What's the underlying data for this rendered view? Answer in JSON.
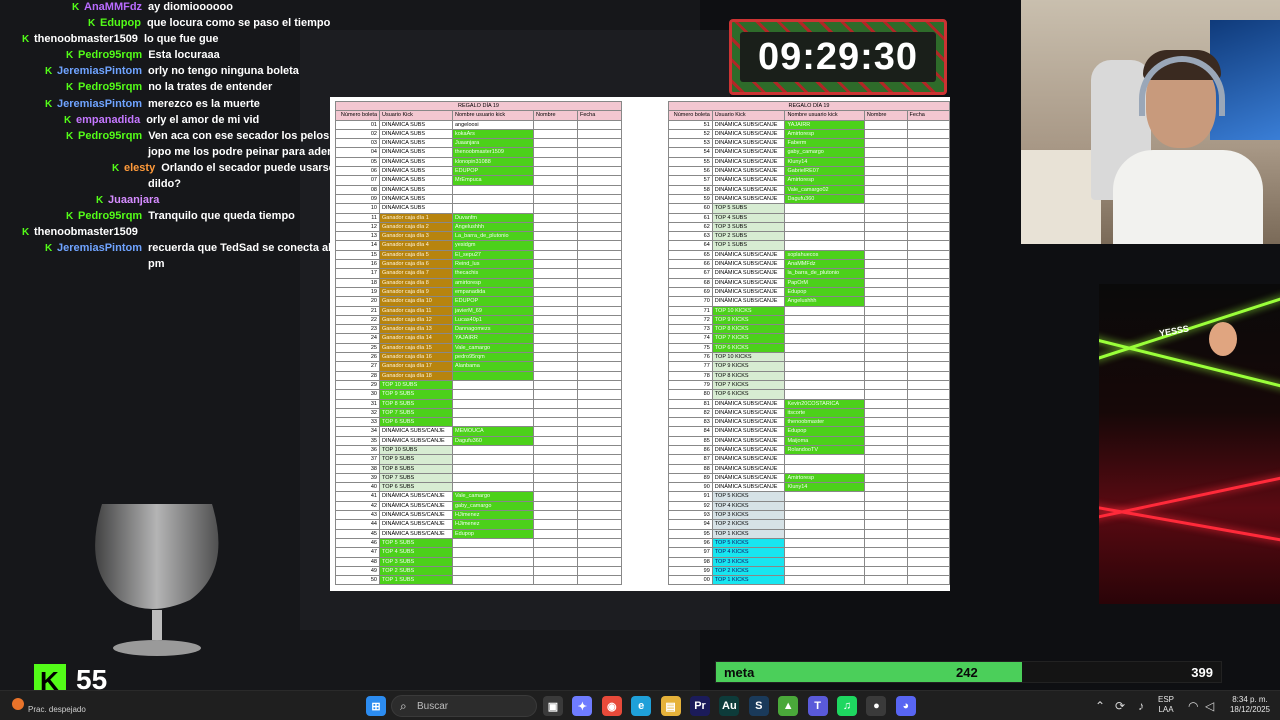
{
  "chat": {
    "messages": [
      {
        "user": "AnaMMFdz",
        "color": "#b96bff",
        "text": "ay diomioooooo"
      },
      {
        "user": "Edupop",
        "color": "#53fc18",
        "text": "que locura como se paso el tiempo"
      },
      {
        "user": "thenoobmaster1509",
        "color": "#ffffff",
        "text": "lo que fue gue"
      },
      {
        "user": "Pedro95rqm",
        "color": "#53fc18",
        "text": "Esta locuraaa"
      },
      {
        "user": "JeremiasPintom",
        "color": "#6fa3ff",
        "text": "orly no tengo ninguna boleta"
      },
      {
        "user": "Pedro95rqm",
        "color": "#53fc18",
        "text": "no la trates de entender"
      },
      {
        "user": "JeremiasPintom",
        "color": "#6fa3ff",
        "text": "merezco es la muerte"
      },
      {
        "user": "empanadida",
        "color": "#c477ff",
        "text": "orly el amor de mi vid"
      },
      {
        "user": "Pedro95rqm",
        "color": "#53fc18",
        "text": "Ven aca con ese secador los pelos del"
      },
      {
        "user": "",
        "color": "#ffffff",
        "text": "jopo me los podre peinar para ader"
      },
      {
        "user": "elesty",
        "color": "#ff9a3a",
        "text": "Orlando el secador puede usarse como"
      },
      {
        "user": "",
        "color": "#ffffff",
        "text": "dildo?"
      },
      {
        "user": "Juaanjara",
        "color": "#d58cff",
        "text": ""
      },
      {
        "user": "Pedro95rqm",
        "color": "#53fc18",
        "text": "Tranquilo que queda tiempo"
      },
      {
        "user": "thenoobmaster1509",
        "color": "#ffffff",
        "text": ""
      },
      {
        "user": "JeremiasPintom",
        "color": "#6fa3ff",
        "text": "recuerda que TedSad se conecta al"
      },
      {
        "user": "",
        "color": "#ffffff",
        "text": "pm"
      }
    ]
  },
  "timer": {
    "value": "09:29:30"
  },
  "sheet": {
    "title": "REGALO DÍA 19",
    "headers": [
      "Número boleta",
      "Usuario Kick",
      "Nombre usuario kick",
      "Nombre",
      "Fecha"
    ],
    "left_rows": [
      [
        "01",
        "DINÁMICA SUBS",
        "angeloosi",
        "w"
      ],
      [
        "02",
        "DINÁMICA SUBS",
        "kokaArs",
        "g"
      ],
      [
        "03",
        "DINÁMICA SUBS",
        "Juaanjara",
        "g"
      ],
      [
        "04",
        "DINÁMICA SUBS",
        "thenoobmaster1509",
        "g"
      ],
      [
        "05",
        "DINÁMICA SUBS",
        "klonopin31088",
        "g"
      ],
      [
        "06",
        "DINÁMICA SUBS",
        "EDUPOP",
        "g"
      ],
      [
        "07",
        "DINÁMICA SUBS",
        "MrEmpuca",
        "g"
      ],
      [
        "08",
        "DINÁMICA SUBS",
        "",
        "w"
      ],
      [
        "09",
        "DINÁMICA SUBS",
        "",
        "w"
      ],
      [
        "10",
        "DINÁMICA SUBS",
        "",
        "w"
      ],
      [
        "11",
        "Ganador caja día 1",
        "Duvanfm",
        "o"
      ],
      [
        "12",
        "Ganador caja día 2",
        "Angelushhh",
        "o"
      ],
      [
        "13",
        "Ganador caja día 3",
        "La_barra_de_plutonio",
        "o"
      ],
      [
        "14",
        "Ganador caja día 4",
        "yesidgm",
        "o"
      ],
      [
        "15",
        "Ganador caja día 5",
        "El_sepu27",
        "o"
      ],
      [
        "16",
        "Ganador caja día 6",
        "Reind_lus",
        "o"
      ],
      [
        "17",
        "Ganador caja día 7",
        "thecachis",
        "o"
      ],
      [
        "18",
        "Ganador caja día 8",
        "amirtoresp",
        "o"
      ],
      [
        "19",
        "Ganador caja día 9",
        "empanadida",
        "o"
      ],
      [
        "20",
        "Ganador caja día 10",
        "EDUPOP",
        "o"
      ],
      [
        "21",
        "Ganador caja día 11",
        "javierM_69",
        "o"
      ],
      [
        "22",
        "Ganador caja día 12",
        "Lucas40p1",
        "o"
      ],
      [
        "23",
        "Ganador caja día 13",
        "Dannagomezs",
        "o"
      ],
      [
        "24",
        "Ganador caja día 14",
        "YAJAIRR",
        "o"
      ],
      [
        "25",
        "Ganador caja día 15",
        "Vale_camargo",
        "o"
      ],
      [
        "26",
        "Ganador caja día 16",
        "pedro95rqm",
        "o"
      ],
      [
        "27",
        "Ganador caja día 17",
        "Alanbama",
        "o"
      ],
      [
        "28",
        "Ganador caja día 18",
        "",
        "o"
      ],
      [
        "29",
        "TOP 10 SUBS",
        "",
        "s"
      ],
      [
        "30",
        "TOP 9 SUBS",
        "",
        "s"
      ],
      [
        "31",
        "TOP 8 SUBS",
        "",
        "s"
      ],
      [
        "32",
        "TOP 7 SUBS",
        "",
        "s"
      ],
      [
        "33",
        "TOP 6 SUBS",
        "",
        "s"
      ],
      [
        "34",
        "DINÁMICA SUBS/CANJE",
        "MEMOUCA",
        "g"
      ],
      [
        "35",
        "DINÁMICA SUBS/CANJE",
        "Dagufu360",
        "g"
      ],
      [
        "36",
        "TOP 10 SUBS",
        "",
        "l"
      ],
      [
        "37",
        "TOP 9 SUBS",
        "",
        "l"
      ],
      [
        "38",
        "TOP 8 SUBS",
        "",
        "l"
      ],
      [
        "39",
        "TOP 7 SUBS",
        "",
        "l"
      ],
      [
        "40",
        "TOP 6 SUBS",
        "",
        "l"
      ],
      [
        "41",
        "DINÁMICA SUBS/CANJE",
        "Vale_camargo",
        "g"
      ],
      [
        "42",
        "DINÁMICA SUBS/CANJE",
        "gaby_camargo",
        "g"
      ],
      [
        "43",
        "DINÁMICA SUBS/CANJE",
        "HJimenez",
        "g"
      ],
      [
        "44",
        "DINÁMICA SUBS/CANJE",
        "HJimenez",
        "g"
      ],
      [
        "45",
        "DINÁMICA SUBS/CANJE",
        "Edupop",
        "g"
      ],
      [
        "46",
        "TOP 5 SUBS",
        "",
        "s"
      ],
      [
        "47",
        "TOP 4 SUBS",
        "",
        "s"
      ],
      [
        "48",
        "TOP 3 SUBS",
        "",
        "s"
      ],
      [
        "49",
        "TOP 2 SUBS",
        "",
        "s"
      ],
      [
        "50",
        "TOP 1 SUBS",
        "",
        "s"
      ]
    ],
    "right_rows": [
      [
        "51",
        "DINÁMICA SUBS/CANJE",
        "YAJAIRR",
        "g"
      ],
      [
        "52",
        "DINÁMICA SUBS/CANJE",
        "Amirtoresp",
        "g"
      ],
      [
        "53",
        "DINÁMICA SUBS/CANJE",
        "Faberm",
        "g"
      ],
      [
        "54",
        "DINÁMICA SUBS/CANJE",
        "gaby_camargo",
        "g"
      ],
      [
        "55",
        "DINÁMICA SUBS/CANJE",
        "Kluny14",
        "g"
      ],
      [
        "56",
        "DINÁMICA SUBS/CANJE",
        "GabrielRE07",
        "g"
      ],
      [
        "57",
        "DINÁMICA SUBS/CANJE",
        "Amirtoresp",
        "g"
      ],
      [
        "58",
        "DINÁMICA SUBS/CANJE",
        "Vale_camargo02",
        "g"
      ],
      [
        "59",
        "DINÁMICA SUBS/CANJE",
        "Dagufu360",
        "g"
      ],
      [
        "60",
        "TOP 5 SUBS",
        "",
        "l"
      ],
      [
        "61",
        "TOP 4 SUBS",
        "",
        "l"
      ],
      [
        "62",
        "TOP 3 SUBS",
        "",
        "l"
      ],
      [
        "63",
        "TOP 2 SUBS",
        "",
        "l"
      ],
      [
        "64",
        "TOP 1 SUBS",
        "",
        "l"
      ],
      [
        "65",
        "DINÁMICA SUBS/CANJE",
        "soplahuecos",
        "g"
      ],
      [
        "66",
        "DINÁMICA SUBS/CANJE",
        "AnaMMFdz",
        "g"
      ],
      [
        "67",
        "DINÁMICA SUBS/CANJE",
        "la_barra_de_plutonio",
        "g"
      ],
      [
        "68",
        "DINÁMICA SUBS/CANJE",
        "PapOrM",
        "g"
      ],
      [
        "69",
        "DINÁMICA SUBS/CANJE",
        "Edupop",
        "g"
      ],
      [
        "70",
        "DINÁMICA SUBS/CANJE",
        "Angelushhh",
        "g"
      ],
      [
        "71",
        "TOP 10 KICKS",
        "",
        "s"
      ],
      [
        "72",
        "TOP 9 KICKS",
        "",
        "s"
      ],
      [
        "73",
        "TOP 8 KICKS",
        "",
        "s"
      ],
      [
        "74",
        "TOP 7 KICKS",
        "",
        "s"
      ],
      [
        "75",
        "TOP 6 KICKS",
        "",
        "s"
      ],
      [
        "76",
        "TOP 10 KICKS",
        "",
        "l"
      ],
      [
        "77",
        "TOP 9 KICKS",
        "",
        "l"
      ],
      [
        "78",
        "TOP 8 KICKS",
        "",
        "l"
      ],
      [
        "79",
        "TOP 7 KICKS",
        "",
        "l"
      ],
      [
        "80",
        "TOP 6 KICKS",
        "",
        "l"
      ],
      [
        "81",
        "DINÁMICA SUBS/CANJE",
        "Kevin20COSTARICA",
        "g"
      ],
      [
        "82",
        "DINÁMICA SUBS/CANJE",
        "itscorte",
        "g"
      ],
      [
        "83",
        "DINÁMICA SUBS/CANJE",
        "thenoobmaster",
        "g"
      ],
      [
        "84",
        "DINÁMICA SUBS/CANJE",
        "Edupop",
        "g"
      ],
      [
        "85",
        "DINÁMICA SUBS/CANJE",
        "Maijoma",
        "g"
      ],
      [
        "86",
        "DINÁMICA SUBS/CANJE",
        "RolandooTV",
        "g"
      ],
      [
        "87",
        "DINÁMICA SUBS/CANJE",
        "",
        "w"
      ],
      [
        "88",
        "DINÁMICA SUBS/CANJE",
        "",
        "w"
      ],
      [
        "89",
        "DINÁMICA SUBS/CANJE",
        "Amirtoresp",
        "g"
      ],
      [
        "90",
        "DINÁMICA SUBS/CANJE",
        "Kluny14",
        "g"
      ],
      [
        "91",
        "TOP 5 KICKS",
        "",
        "e"
      ],
      [
        "92",
        "TOP 4 KICKS",
        "",
        "e"
      ],
      [
        "93",
        "TOP 3 KICKS",
        "",
        "e"
      ],
      [
        "94",
        "TOP 2 KICKS",
        "",
        "e"
      ],
      [
        "95",
        "TOP 1 KICKS",
        "",
        "e"
      ],
      [
        "96",
        "TOP 5 KICKS",
        "",
        "c"
      ],
      [
        "97",
        "TOP 4 KICKS",
        "",
        "c"
      ],
      [
        "98",
        "TOP 3 KICKS",
        "",
        "c"
      ],
      [
        "99",
        "TOP 2 KICKS",
        "",
        "c"
      ],
      [
        "00",
        "TOP 1 KICKS",
        "",
        "c"
      ]
    ]
  },
  "meta": {
    "label": "meta",
    "current": "242",
    "goal": "399",
    "progress": 0.606
  },
  "kick_counter": {
    "icon": "K",
    "count": "55"
  },
  "taskbar": {
    "weather_label": "Prac. despejado",
    "search_placeholder": "Buscar",
    "language_1": "ESP",
    "language_2": "LAA",
    "time": "8:34 p. m.",
    "date": "18/12/2025",
    "apps": [
      {
        "name": "start",
        "color": "#2c8cf0",
        "glyph": "⊞"
      },
      {
        "name": "taskview",
        "color": "#3a3a3a",
        "glyph": "▣"
      },
      {
        "name": "copilot",
        "color": "#6f7cff",
        "glyph": "✦"
      },
      {
        "name": "chrome",
        "color": "#e84a3a",
        "glyph": "◉"
      },
      {
        "name": "edge",
        "color": "#1fa0d9",
        "glyph": "e"
      },
      {
        "name": "explorer",
        "color": "#e6b23a",
        "glyph": "▤"
      },
      {
        "name": "premiere",
        "color": "#1b1b5a",
        "glyph": "Pr"
      },
      {
        "name": "audition",
        "color": "#0d3b3a",
        "glyph": "Au"
      },
      {
        "name": "steam",
        "color": "#1a3a5a",
        "glyph": "S"
      },
      {
        "name": "nvidia",
        "color": "#4aa83a",
        "glyph": "▲"
      },
      {
        "name": "teams",
        "color": "#5a5ad9",
        "glyph": "T"
      },
      {
        "name": "spotify",
        "color": "#1ed760",
        "glyph": "♫"
      },
      {
        "name": "obs",
        "color": "#3a3a3a",
        "glyph": "●"
      },
      {
        "name": "discord",
        "color": "#5865f2",
        "glyph": "◕"
      }
    ]
  }
}
